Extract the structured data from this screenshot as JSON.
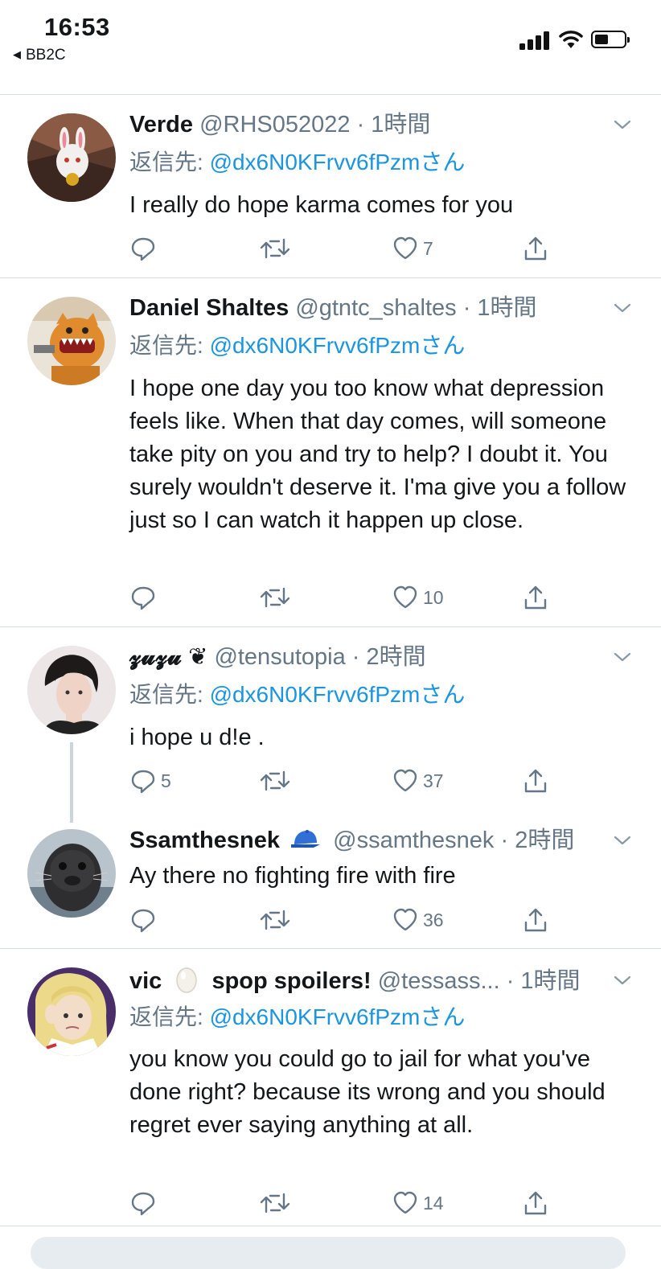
{
  "status_bar": {
    "time": "16:53",
    "back_label": "BB2C"
  },
  "tweets": [
    {
      "name": "Verde",
      "handle": "@RHS052022",
      "time": "· 1時間",
      "reply_prefix": "返信先: ",
      "reply_to": "@dx6N0KFrvv6fPzm",
      "reply_suffix": "さん",
      "text": "I really do hope karma comes for you",
      "replies": "",
      "likes": "7"
    },
    {
      "name": "Daniel Shaltes",
      "handle": "@gtntc_shaltes",
      "time": "· 1時間",
      "reply_prefix": "返信先: ",
      "reply_to": "@dx6N0KFrvv6fPzm",
      "reply_suffix": "さん",
      "text": "I hope one day you too know what depression feels like. When that day comes, will someone take pity on you and try to help? I doubt it. You surely wouldn't deserve it. I'ma give you a follow just so I can watch it happen up close.",
      "replies": "",
      "likes": "10"
    },
    {
      "name": "𝔃𝓾𝔃𝓾 ❦",
      "handle": "@tensutopia",
      "time": "· 2時間",
      "reply_prefix": "返信先: ",
      "reply_to": "@dx6N0KFrvv6fPzm",
      "reply_suffix": "さん",
      "text": "i hope u d!e .",
      "replies": "5",
      "likes": "37"
    },
    {
      "name": "Ssamthesnek",
      "handle": "@ssamthesnek",
      "time": "· 2時間",
      "text": "Ay there no fighting fire with fire",
      "replies": "",
      "likes": "36"
    },
    {
      "name": "vic",
      "name_extra": "spop spoilers!",
      "handle": "@tessass...",
      "time": "· 1時間",
      "reply_prefix": "返信先: ",
      "reply_to": "@dx6N0KFrvv6fPzm",
      "reply_suffix": "さん",
      "text": "you know you could go to jail for what you've done right? because its wrong and you should regret ever saying anything at all.",
      "replies": "",
      "likes": "14"
    }
  ],
  "icons": {
    "reply": "reply-icon",
    "retweet": "retweet-icon",
    "like": "heart-icon",
    "share": "share-icon",
    "caret": "chevron-down-icon"
  },
  "colors": {
    "accent": "#1b95e0",
    "muted": "#657786",
    "divider": "#d6dbe0"
  }
}
